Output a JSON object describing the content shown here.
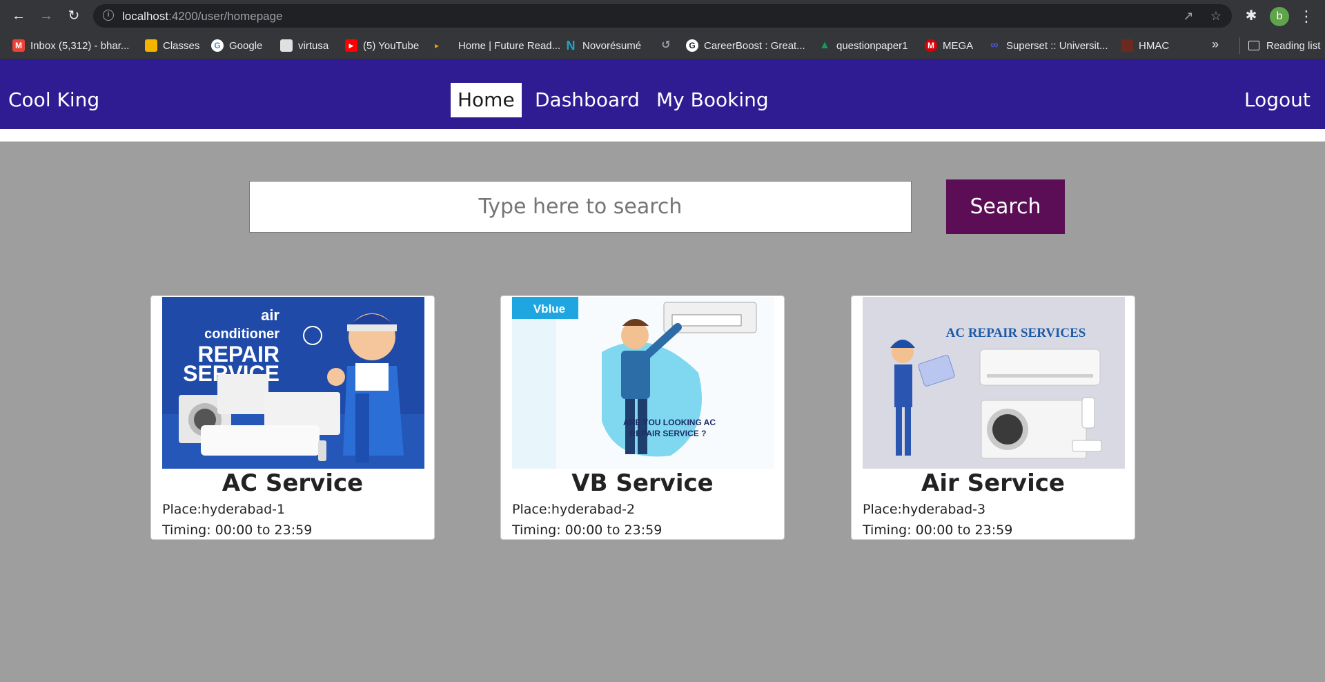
{
  "browser": {
    "url_host": "localhost",
    "url_path": ":4200/user/homepage",
    "profile_initial": "b",
    "bookmarks": [
      {
        "label": "Inbox (5,312) - bhar...",
        "icon": "gmail-icon",
        "color": "#ea4335"
      },
      {
        "label": "Classes",
        "icon": "classroom-icon",
        "color": "#f4b400"
      },
      {
        "label": "Google",
        "icon": "google-icon",
        "color": "#4285f4"
      },
      {
        "label": "virtusa",
        "icon": "virtusa-icon",
        "color": "#e0e0e0"
      },
      {
        "label": "(5) YouTube",
        "icon": "youtube-icon",
        "color": "#ff0000"
      },
      {
        "label": "Home | Future Read...",
        "icon": "future-ready-icon",
        "color": "#f29900"
      },
      {
        "label": "Novorésumé",
        "icon": "novoresume-icon",
        "color": "#18a9c9"
      },
      {
        "label": "",
        "icon": "history-icon",
        "color": "#9aa0a6"
      },
      {
        "label": "CareerBoost : Great...",
        "icon": "careerboost-icon",
        "color": "#ffffff"
      },
      {
        "label": "questionpaper1",
        "icon": "drive-icon",
        "color": "#0f9d58"
      },
      {
        "label": "MEGA",
        "icon": "mega-icon",
        "color": "#d90007"
      },
      {
        "label": "Superset :: Universit...",
        "icon": "superset-icon",
        "color": "#4a55d6"
      },
      {
        "label": "HMAC",
        "icon": "hmac-icon",
        "color": "#6b2a1f"
      }
    ],
    "more_label": "»",
    "reading_list_label": "Reading list"
  },
  "navbar": {
    "brand": "Cool King",
    "links": [
      "Home",
      "Dashboard",
      "My Booking"
    ],
    "active": "Home",
    "logout": "Logout"
  },
  "search": {
    "placeholder": "Type here to search",
    "button_label": "Search"
  },
  "cards": [
    {
      "title": "AC Service",
      "place": "Place:hyderabad-1",
      "timing": "Timing: 00:00 to 23:59",
      "image_text": [
        "air",
        "conditioner",
        "REPAIR",
        "SERVICE"
      ]
    },
    {
      "title": "VB Service",
      "place": "Place:hyderabad-2",
      "timing": "Timing: 00:00 to 23:59",
      "image_text": [
        "Vblue",
        "ARE YOU LOOKING AC",
        "REPAIR SERVICE ?"
      ]
    },
    {
      "title": "Air Service",
      "place": "Place:hyderabad-3",
      "timing": "Timing: 00:00 to 23:59",
      "image_text": [
        "AC REPAIR SERVICES"
      ]
    }
  ],
  "colors": {
    "navbar_bg": "#2f1c92",
    "search_button_bg": "#5b0d55",
    "page_bg": "#9e9e9e"
  }
}
